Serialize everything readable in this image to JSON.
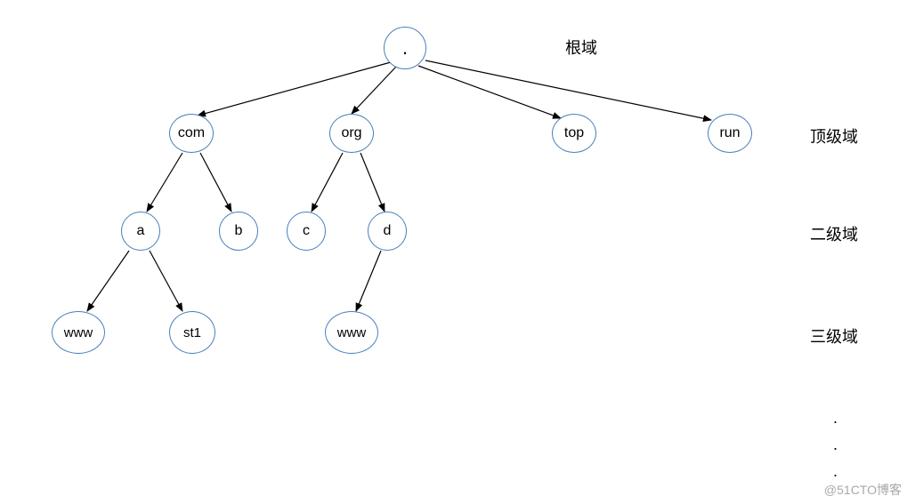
{
  "tree": {
    "root": {
      "label": "."
    },
    "level1": {
      "com": {
        "label": "com"
      },
      "org": {
        "label": "org"
      },
      "top": {
        "label": "top"
      },
      "run": {
        "label": "run"
      }
    },
    "level2": {
      "a": {
        "label": "a"
      },
      "b": {
        "label": "b"
      },
      "c": {
        "label": "c"
      },
      "d": {
        "label": "d"
      }
    },
    "level3": {
      "www_a": {
        "label": "www"
      },
      "st1": {
        "label": "st1"
      },
      "www_d": {
        "label": "www"
      }
    }
  },
  "labels": {
    "root": "根域",
    "level1": "顶级域",
    "level2": "二级域",
    "level3": "三级域"
  },
  "dots": {
    "d1": ".",
    "d2": ".",
    "d3": "."
  },
  "watermark": "@51CTO博客",
  "colors": {
    "node_border": "#4a7ebb",
    "edge": "#000000"
  }
}
